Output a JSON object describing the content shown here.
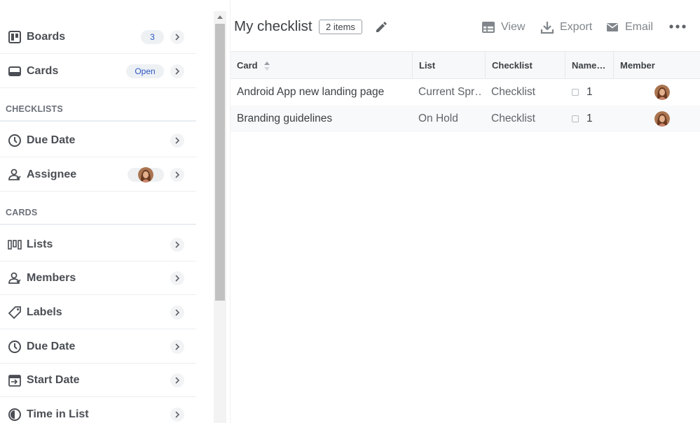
{
  "sidebar": {
    "top_items": [
      {
        "label": "Boards",
        "badge": "3"
      },
      {
        "label": "Cards",
        "badge": "Open"
      }
    ],
    "sections": [
      {
        "title": "CHECKLISTS",
        "items": [
          {
            "label": "Due Date",
            "icon": "clock-icon"
          },
          {
            "label": "Assignee",
            "icon": "person-icon"
          }
        ]
      },
      {
        "title": "CARDS",
        "items": [
          {
            "label": "Lists",
            "icon": "lists-icon"
          },
          {
            "label": "Members",
            "icon": "person-icon"
          },
          {
            "label": "Labels",
            "icon": "label-icon"
          },
          {
            "label": "Due Date",
            "icon": "clock-icon"
          },
          {
            "label": "Start Date",
            "icon": "start-date-icon"
          },
          {
            "label": "Time in List",
            "icon": "timer-icon"
          }
        ]
      }
    ]
  },
  "header": {
    "title": "My checklist",
    "count": "2 items",
    "actions": {
      "view": "View",
      "export": "Export",
      "email": "Email"
    }
  },
  "table": {
    "columns": [
      "Card",
      "List",
      "Checklist",
      "Name…",
      "Member"
    ],
    "rows": [
      {
        "card": "Android App new landing page",
        "list": "Current Spr…",
        "checklist": "Checklist",
        "items": "1"
      },
      {
        "card": "Branding guidelines",
        "list": "On Hold",
        "checklist": "Checklist",
        "items": "1"
      }
    ]
  },
  "colors": {
    "accent": "#2b57c4",
    "text": "#3c4043",
    "muted": "#80868b",
    "row_alt": "#f7f9fb"
  }
}
